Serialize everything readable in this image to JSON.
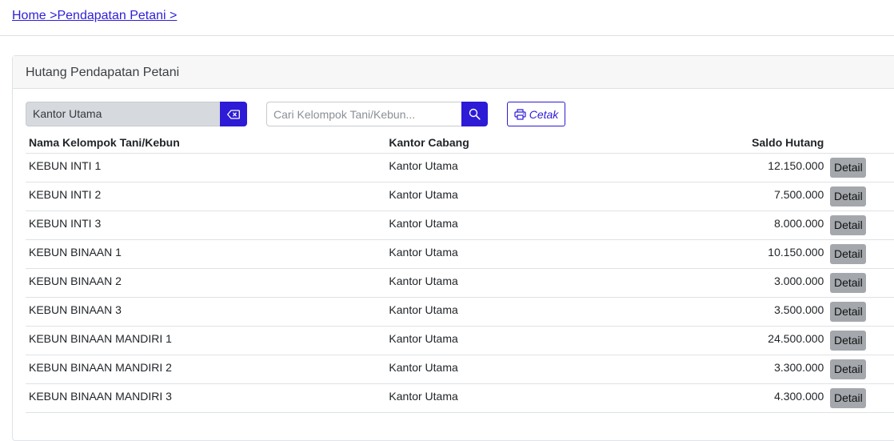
{
  "breadcrumb": {
    "home": "Home",
    "sep1": " >",
    "current": "Pendapatan Petani",
    "sep2": " >"
  },
  "card": {
    "title": "Hutang Pendapatan Petani"
  },
  "filter": {
    "branch_value": "Kantor Utama",
    "clear_icon": "backspace-icon"
  },
  "search": {
    "placeholder": "Cari Kelompok Tani/Kebun...",
    "value": "",
    "icon": "search-icon"
  },
  "print": {
    "label": "Cetak",
    "icon": "printer-icon"
  },
  "table": {
    "headers": {
      "name": "Nama Kelompok Tani/Kebun",
      "branch": "Kantor Cabang",
      "saldo": "Saldo Hutang"
    },
    "detail_label": "Detail",
    "rows": [
      {
        "name": "KEBUN INTI 1",
        "branch": "Kantor Utama",
        "saldo": "12.150.000"
      },
      {
        "name": "KEBUN INTI 2",
        "branch": "Kantor Utama",
        "saldo": "7.500.000"
      },
      {
        "name": "KEBUN INTI 3",
        "branch": "Kantor Utama",
        "saldo": "8.000.000"
      },
      {
        "name": "KEBUN BINAAN 1",
        "branch": "Kantor Utama",
        "saldo": "10.150.000"
      },
      {
        "name": "KEBUN BINAAN 2",
        "branch": "Kantor Utama",
        "saldo": "3.000.000"
      },
      {
        "name": "KEBUN BINAAN 3",
        "branch": "Kantor Utama",
        "saldo": "3.500.000"
      },
      {
        "name": "KEBUN BINAAN MANDIRI 1",
        "branch": "Kantor Utama",
        "saldo": "24.500.000"
      },
      {
        "name": "KEBUN BINAAN MANDIRI 2",
        "branch": "Kantor Utama",
        "saldo": "3.300.000"
      },
      {
        "name": "KEBUN BINAAN MANDIRI 3",
        "branch": "Kantor Utama",
        "saldo": "4.300.000"
      }
    ]
  },
  "colors": {
    "accent": "#2d1bd6",
    "link": "#2f1fd6",
    "detail_button": "#a4a8ad",
    "filter_bg": "#d6d9dd"
  }
}
